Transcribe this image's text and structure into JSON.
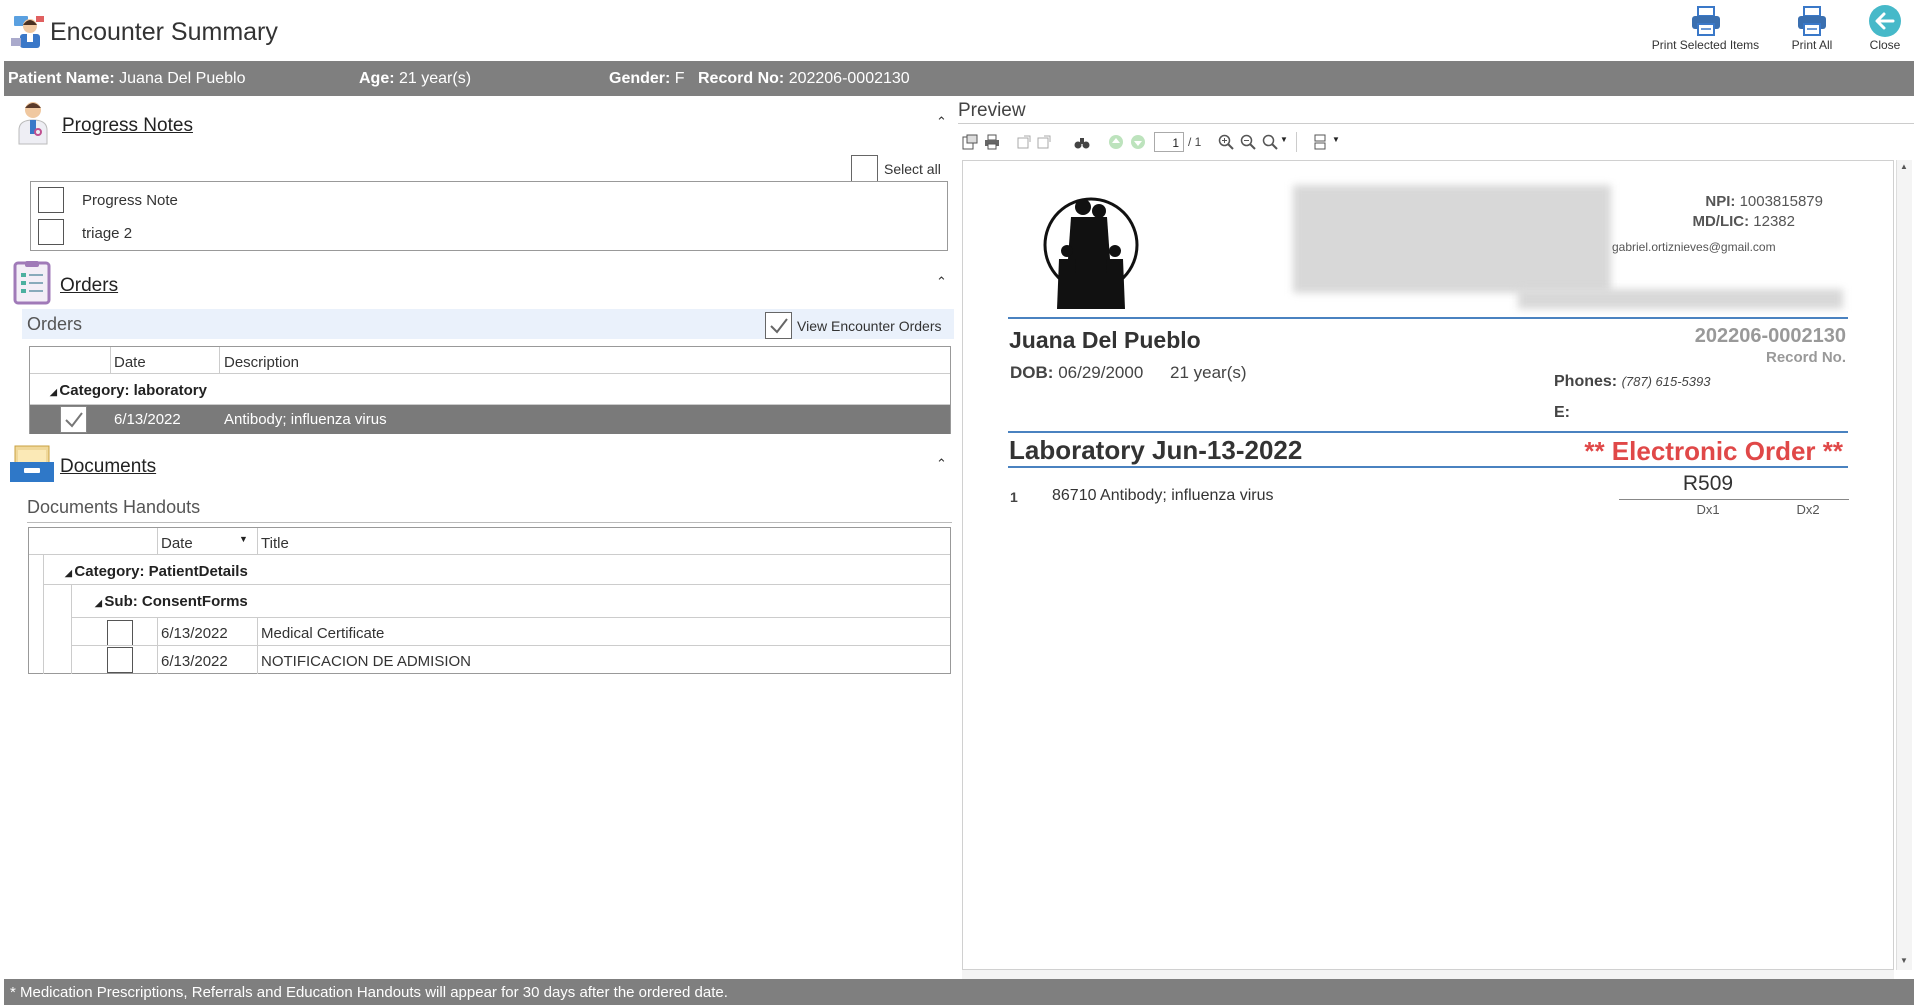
{
  "app": {
    "title": "Encounter Summary",
    "toolbar": {
      "print_selected": "Print Selected Items",
      "print_all": "Print All",
      "close": "Close"
    }
  },
  "patient": {
    "name_label": "Patient Name:",
    "name": "Juana Del Pueblo",
    "age_label": "Age:",
    "age": "21 year(s)",
    "gender_label": "Gender:",
    "gender": "F",
    "record_label": "Record No:",
    "record": "202206-0002130"
  },
  "progress_notes": {
    "title": "Progress Notes",
    "select_all": "Select all",
    "items": [
      {
        "label": "Progress Note",
        "checked": false
      },
      {
        "label": "triage 2",
        "checked": false
      }
    ]
  },
  "orders": {
    "title": "Orders",
    "subtitle": "Orders",
    "view_encounter_orders": "View Encounter Orders",
    "columns": [
      "Date",
      "Description"
    ],
    "category": "Category: laboratory",
    "rows": [
      {
        "date": "6/13/2022",
        "description": "Antibody; influenza virus",
        "checked": true
      }
    ]
  },
  "documents": {
    "title": "Documents",
    "subtitle": "Documents Handouts",
    "columns": [
      "Date",
      "Title"
    ],
    "category": "Category: PatientDetails",
    "sub": "Sub: ConsentForms",
    "rows": [
      {
        "date": "6/13/2022",
        "title": "Medical Certificate"
      },
      {
        "date": "6/13/2022",
        "title": "NOTIFICACION DE ADMISION"
      }
    ]
  },
  "preview": {
    "title": "Preview",
    "page_input": "1",
    "page_total": "/ 1",
    "report": {
      "npi_label": "NPI:",
      "npi": "1003815879",
      "mdlic_label": "MD/LIC:",
      "mdlic": "12382",
      "email": "gabriel.ortiznieves@gmail.com",
      "patient_name": "Juana Del Pueblo",
      "record_no": "202206-0002130",
      "record_no_label": "Record No.",
      "dob_label": "DOB:",
      "dob": "06/29/2000",
      "age": "21 year(s)",
      "phones_label": "Phones:",
      "phones": "(787) 615-5393",
      "e_label": "E:",
      "order_title": "Laboratory Jun-13-2022",
      "electronic_order": "** Electronic Order **",
      "line_no": "1",
      "line_text": "86710 Antibody; influenza virus",
      "dx_code": "R509",
      "dx1": "Dx1",
      "dx2": "Dx2"
    }
  },
  "footer": {
    "note": "* Medication Prescriptions, Referrals and Education Handouts will appear for 30 days after the ordered date."
  },
  "colors": {
    "bar": "#7f7f7f",
    "selected_row": "#7a7a7a",
    "accent_blue": "#4a82c0",
    "electronic_order_red": "#e04848",
    "close_teal": "#46b9c9"
  }
}
